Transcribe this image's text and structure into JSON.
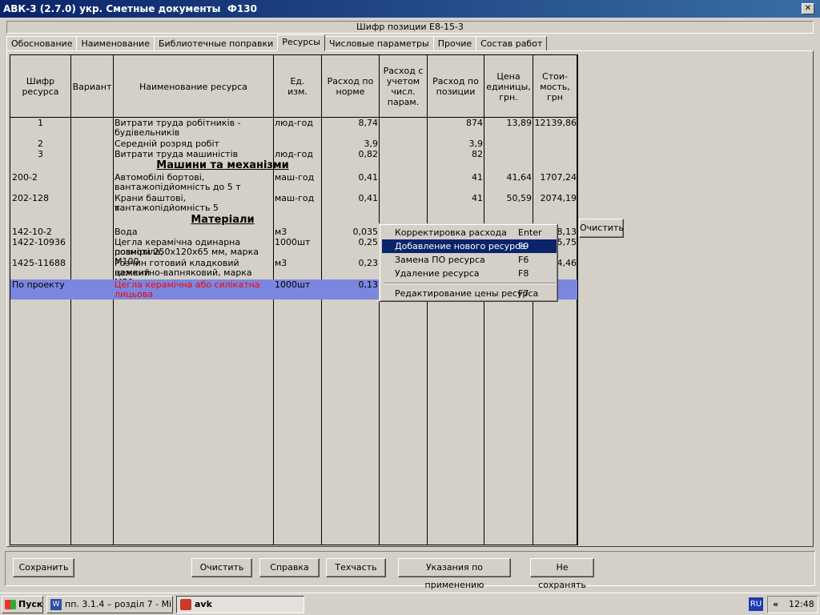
{
  "window": {
    "title": "АВК-3 (2.7.0)  укр.  Сметные документы",
    "form": "Ф130",
    "close": "✕"
  },
  "position": {
    "label": "Шифр позиции   Е8-15-3"
  },
  "tabs": [
    "Обоснование",
    "Наименование",
    "Библиотечные поправки",
    "Ресурсы",
    "Числовые параметры",
    "Прочие",
    "Состав работ"
  ],
  "active_tab": "Ресурсы",
  "table": {
    "headers": {
      "code": "Шифр\nресурса",
      "variant": "Вариант",
      "name": "Наименование ресурса",
      "unit": "Ед.\nизм.",
      "norm": "Расход по\nнорме",
      "calc": "Расход с\nучетом\nчисл.\nпарам.",
      "pos": "Расход по\nпозиции",
      "price": "Цена\nединицы,\nгрн.",
      "cost": "Стои-\nмость,\nгрн"
    },
    "rows": [
      {
        "code": "1",
        "name1": "Витрати труда робітників -",
        "name2": "будівельників",
        "unit": "люд-год",
        "norm": "8,74",
        "pos": "874",
        "price": "13,89",
        "cost": "12139,86"
      },
      {
        "code": "2",
        "name1": "Середній розряд робіт",
        "name2": "",
        "unit": "",
        "norm": "3,9",
        "pos": "3,9",
        "price": "",
        "cost": ""
      },
      {
        "code": "3",
        "name1": "Витрати труда машиністів",
        "name2": "",
        "unit": "люд-год",
        "norm": "0,82",
        "pos": "82",
        "price": "",
        "cost": ""
      },
      {
        "code": "200-2",
        "name1": "Автомобілі бортові,",
        "name2": "вантажопідйомність до 5 т",
        "unit": "маш-год",
        "norm": "0,41",
        "pos": "41",
        "price": "41,64",
        "cost": "1707,24"
      },
      {
        "code": "202-128",
        "name1": "Крани баштові, вантажопідйомність 5",
        "name2": "т",
        "unit": "маш-год",
        "norm": "0,41",
        "pos": "41",
        "price": "50,59",
        "cost": "2074,19"
      },
      {
        "code": "142-10-2",
        "name1": "Вода",
        "name2": "",
        "unit": "м3",
        "norm": "0,035",
        "pos": "",
        "price": "",
        "cost": "8,13"
      },
      {
        "code": "1422-10936",
        "name1": "Цегла керамічна одинарна повнотіла,",
        "name2": "розміри 250x120x65 мм, марка М100",
        "unit": "1000шт",
        "norm": "0,25",
        "pos": "",
        "price": "",
        "cost": "5,75"
      },
      {
        "code": "1425-11688",
        "name1": "Розчин готовий кладковий важкий",
        "name2": "цементно-вапняковий, марка М50",
        "unit": "м3",
        "norm": "0,23",
        "pos": "",
        "price": "",
        "cost": "4,46"
      },
      {
        "code": "По проекту",
        "name1": "Цегла керамічна або силікатна",
        "name2": "лицьова",
        "unit": "1000шт",
        "norm": "0,13",
        "pos": "",
        "price": "",
        "cost": ""
      }
    ],
    "sections": {
      "machines": "Машини та механізми",
      "materials": "Матеріали"
    }
  },
  "context_menu": [
    {
      "label": "Корректировка расхода",
      "key": "Enter"
    },
    {
      "label": "Добавление нового ресурса",
      "key": "F9"
    },
    {
      "label": "Замена ПО ресурса",
      "key": "F6"
    },
    {
      "label": "Удаление ресурса",
      "key": "F8"
    },
    {
      "label": "Редактирование цены ресурса",
      "key": "F7"
    }
  ],
  "side_button": "Очистить",
  "bottom_buttons": {
    "save": "Сохранить",
    "clear": "Очистить",
    "help": "Справка",
    "techpart": "Техчасть",
    "instructions": "Указания по применению",
    "nosave": "Не сохранять"
  },
  "taskbar": {
    "start": "Пуск",
    "task1": "пп. 3.1.4 – розділ 7 - Mi...",
    "task2": "avk",
    "lang": "RU",
    "chevron": "«",
    "time": "12:48"
  },
  "colors": {
    "selected_row": "#7b86de",
    "menu_highlight": "#0a246a",
    "title_bar": "#0a246a",
    "red_text": "#ff0000"
  }
}
